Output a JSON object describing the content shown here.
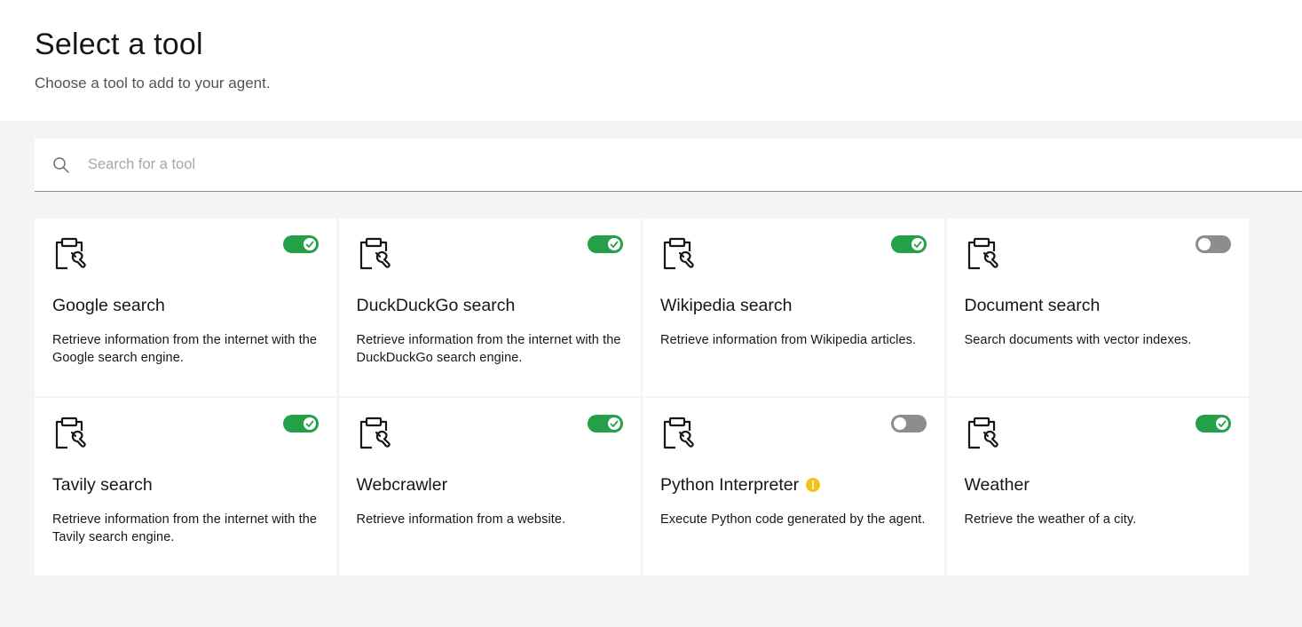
{
  "header": {
    "title": "Select a tool",
    "subtitle": "Choose a tool to add to your agent."
  },
  "search": {
    "placeholder": "Search for a tool",
    "value": ""
  },
  "colors": {
    "toggle_on": "#24a148",
    "toggle_off": "#8d8d8d",
    "warning": "#f1c21b",
    "background": "#f4f4f4"
  },
  "tools": [
    {
      "name": "Google search",
      "description": "Retrieve information from the internet with the Google search engine.",
      "enabled": true,
      "icon": "clipboard-wrench-icon",
      "warning": false
    },
    {
      "name": "DuckDuckGo search",
      "description": "Retrieve information from the internet with the DuckDuckGo search engine.",
      "enabled": true,
      "icon": "clipboard-wrench-icon",
      "warning": false
    },
    {
      "name": "Wikipedia search",
      "description": "Retrieve information from Wikipedia articles.",
      "enabled": true,
      "icon": "clipboard-wrench-icon",
      "warning": false
    },
    {
      "name": "Document search",
      "description": "Search documents with vector indexes.",
      "enabled": false,
      "icon": "clipboard-wrench-icon",
      "warning": false
    },
    {
      "name": "Tavily search",
      "description": "Retrieve information from the internet with the Tavily search engine.",
      "enabled": true,
      "icon": "clipboard-wrench-icon",
      "warning": false
    },
    {
      "name": "Webcrawler",
      "description": "Retrieve information from a website.",
      "enabled": true,
      "icon": "clipboard-wrench-icon",
      "warning": false
    },
    {
      "name": "Python Interpreter",
      "description": "Execute Python code generated by the agent.",
      "enabled": false,
      "icon": "clipboard-wrench-icon",
      "warning": true
    },
    {
      "name": "Weather",
      "description": "Retrieve the weather of a city.",
      "enabled": true,
      "icon": "clipboard-wrench-icon",
      "warning": false
    }
  ]
}
